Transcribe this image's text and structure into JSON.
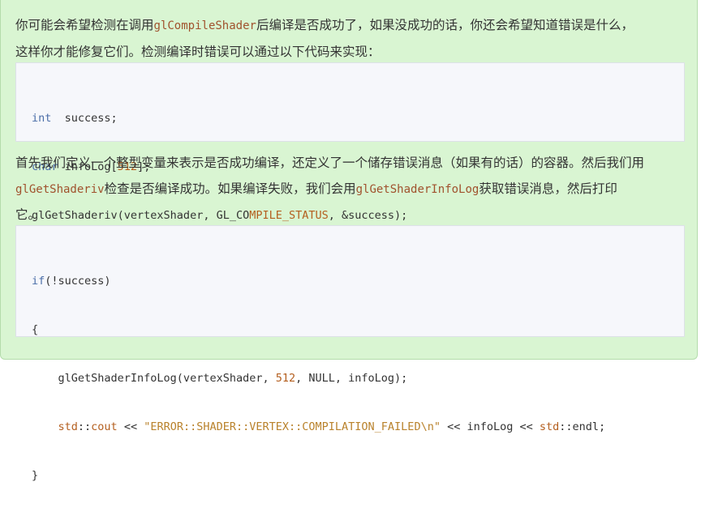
{
  "para1": {
    "line1_a": "你可能会希望检测在调用",
    "line1_code": "glCompileShader",
    "line1_b": "后编译是否成功了，如果没成功的话，你还会希望知道错误是什么，",
    "line2": "这样你才能修复它们。检测编译时错误可以通过以下代码来实现："
  },
  "code1": {
    "l1_kw": "int",
    "l1_rest": "  success;",
    "l2_kw": "char",
    "l2_a": " infoLog[",
    "l2_num": "512",
    "l2_b": "];",
    "l3_a": "glGetShaderiv(vertexShader, GL_CO",
    "l3_id": "MPILE_STATUS",
    "l3_b": ", &success);"
  },
  "para2": {
    "line1": "首先我们定义一个整型变量来表示是否成功编译，还定义了一个储存错误消息（如果有的话）的容器。然后我们用",
    "line2_code1": "glGetShaderiv",
    "line2_a": "检查是否编译成功。如果编译失败，我们会用",
    "line2_code2": "glGetShaderInfoLog",
    "line2_b": "获取错误消息，然后打印",
    "line3": "它。"
  },
  "code2": {
    "l1_kw": "if",
    "l1_rest": "(!success)",
    "l2": "{",
    "l3_a": "    glGetShaderInfoLog(vertexShader, ",
    "l3_num": "512",
    "l3_b": ", NULL, infoLog);",
    "l4_indent": "    ",
    "l4_std1": "std",
    "l4_sep1": "::",
    "l4_cout": "cout",
    "l4_a": " << ",
    "l4_str": "\"ERROR::SHADER::VERTEX::COMPILATION_FAILED\\n\"",
    "l4_b": " << infoLog << ",
    "l4_std2": "std",
    "l4_c": "::endl;",
    "l5": "}"
  }
}
